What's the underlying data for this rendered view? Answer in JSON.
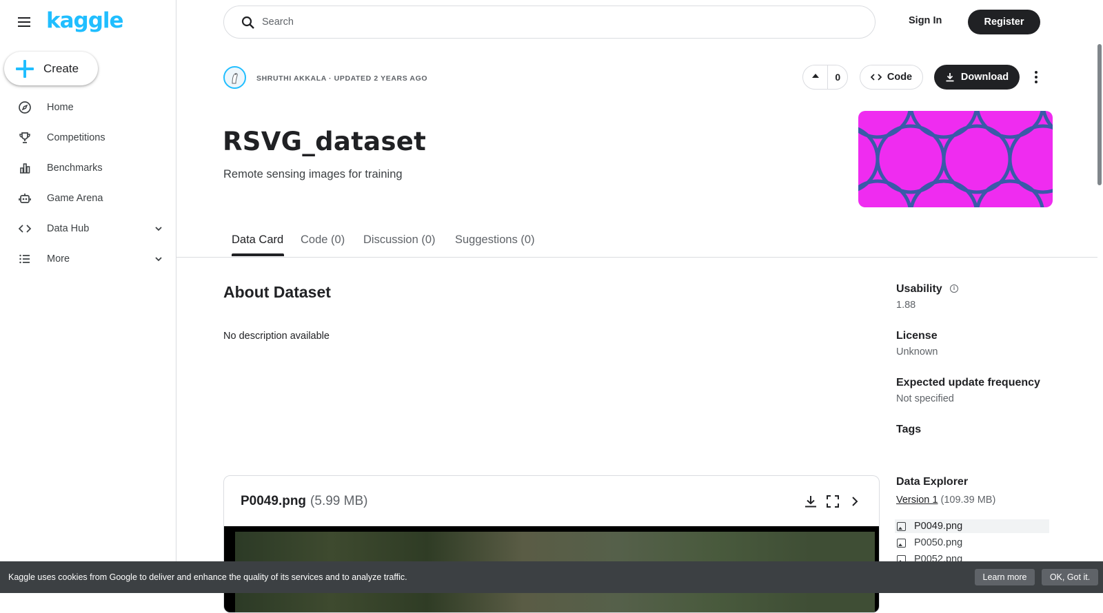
{
  "sidebar": {
    "logo": "kaggle",
    "create_label": "Create",
    "items": [
      {
        "label": "Home",
        "icon": "compass-icon"
      },
      {
        "label": "Competitions",
        "icon": "trophy-icon"
      },
      {
        "label": "Benchmarks",
        "icon": "bar-chart-icon"
      },
      {
        "label": "Game Arena",
        "icon": "robot-icon"
      },
      {
        "label": "Data Hub",
        "icon": "code-brackets-icon"
      },
      {
        "label": "More",
        "icon": "list-icon"
      }
    ]
  },
  "header": {
    "search_placeholder": "Search",
    "signin_label": "Sign In",
    "register_label": "Register"
  },
  "dataset": {
    "owner_line": "SHRUTHI AKKALA · UPDATED 2 YEARS AGO",
    "vote_count": "0",
    "code_label": "Code",
    "download_label": "Download",
    "title": "RSVG_dataset",
    "subtitle": "Remote sensing images for training",
    "cover_color": "#ef2cf0"
  },
  "tabs": [
    {
      "label": "Data Card"
    },
    {
      "label": "Code (0)"
    },
    {
      "label": "Discussion (0)"
    },
    {
      "label": "Suggestions (0)"
    }
  ],
  "about": {
    "heading": "About Dataset",
    "description": "No description available"
  },
  "meta": {
    "usability_label": "Usability",
    "usability_value": "1.88",
    "license_label": "License",
    "license_value": "Unknown",
    "frequency_label": "Expected update frequency",
    "frequency_value": "Not specified",
    "tags_label": "Tags",
    "explorer_label": "Data Explorer",
    "version_link": "Version 1",
    "version_size": "(109.39 MB)",
    "files": [
      "P0049.png",
      "P0050.png",
      "P0052.png"
    ]
  },
  "preview": {
    "filename": "P0049.png",
    "size": "(5.99 MB)"
  },
  "cookie": {
    "text": "Kaggle uses cookies from Google to deliver and enhance the quality of its services and to analyze traffic.",
    "learn_more": "Learn more",
    "ok": "OK, Got it."
  }
}
